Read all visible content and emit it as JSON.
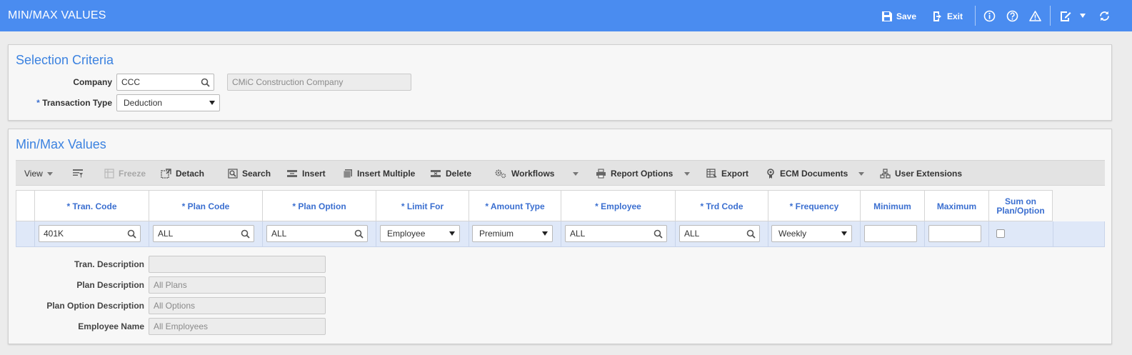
{
  "header": {
    "title": "MIN/MAX VALUES",
    "save_label": "Save",
    "exit_label": "Exit"
  },
  "selection": {
    "title": "Selection Criteria",
    "company_label": "Company",
    "company_value": "CCC",
    "company_name": "CMiC Construction Company",
    "trans_type_required": "*",
    "trans_type_label": "Transaction Type",
    "trans_type_value": "Deduction"
  },
  "minmax": {
    "title": "Min/Max Values",
    "toolbar": {
      "view": "View",
      "freeze": "Freeze",
      "detach": "Detach",
      "search": "Search",
      "insert": "Insert",
      "insert_multiple": "Insert Multiple",
      "delete": "Delete",
      "workflows": "Workflows",
      "report_options": "Report Options",
      "export": "Export",
      "ecm_documents": "ECM Documents",
      "user_extensions": "User Extensions"
    },
    "columns": [
      "* Tran. Code",
      "* Plan Code",
      "* Plan Option",
      "* Limit For",
      "* Amount Type",
      "* Employee",
      "* Trd Code",
      "* Frequency",
      "Minimum",
      "Maximum",
      "Sum on Plan/Option"
    ],
    "row": {
      "tran_code": "401K",
      "plan_code": "ALL",
      "plan_option": "ALL",
      "limit_for": "Employee",
      "amount_type": "Premium",
      "employee": "ALL",
      "trd_code": "ALL",
      "frequency": "Weekly",
      "minimum": "",
      "maximum": ""
    },
    "details": {
      "tran_desc_label": "Tran. Description",
      "tran_desc_value": "",
      "plan_desc_label": "Plan Description",
      "plan_desc_value": "All Plans",
      "plan_option_desc_label": "Plan Option Description",
      "plan_option_desc_value": "All Options",
      "employee_name_label": "Employee Name",
      "employee_name_value": "All Employees"
    }
  },
  "colors": {
    "header_bg": "#4a8cf0",
    "title_blue": "#3b82e0",
    "column_blue": "#3b6fd0",
    "row_selected": "#dfe8f8"
  }
}
